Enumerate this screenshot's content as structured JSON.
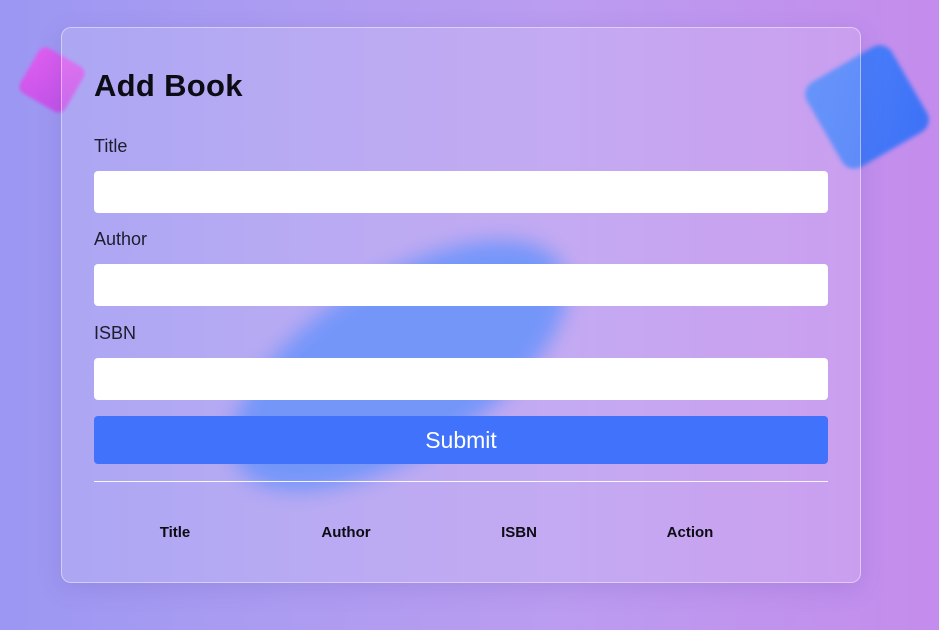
{
  "form": {
    "heading": "Add Book",
    "fields": [
      {
        "label": "Title",
        "value": "",
        "placeholder": ""
      },
      {
        "label": "Author",
        "value": "",
        "placeholder": ""
      },
      {
        "label": "ISBN",
        "value": "",
        "placeholder": ""
      }
    ],
    "submit_label": "Submit"
  },
  "table": {
    "headers": [
      "Title",
      "Author",
      "ISBN",
      "Action"
    ],
    "rows": []
  },
  "colors": {
    "accent": "#4172fb",
    "background_start": "#9b97f2",
    "background_end": "#c48cec",
    "decor_pink": "#e35cf0",
    "decor_blue": "#4f84fb"
  }
}
